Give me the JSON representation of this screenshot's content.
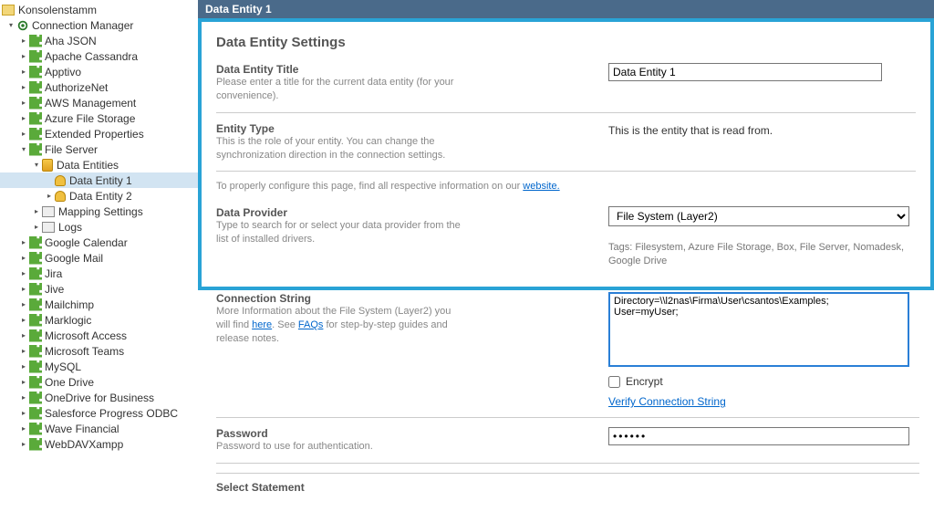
{
  "tree": {
    "root_label": "Konsolenstamm",
    "connection_manager": "Connection Manager",
    "items": [
      "Aha JSON",
      "Apache Cassandra",
      "Apptivo",
      "AuthorizeNet",
      "AWS Management",
      "Azure File Storage",
      "Extended Properties",
      "File Server",
      "Google Calendar",
      "Google Mail",
      "Jira",
      "Jive",
      "Mailchimp",
      "Marklogic",
      "Microsoft Access",
      "Microsoft Teams",
      "MySQL",
      "One Drive",
      "OneDrive for Business",
      "Salesforce Progress ODBC",
      "Wave Financial",
      "WebDAVXampp"
    ],
    "file_server_children": {
      "data_entities": "Data Entities",
      "entity1": "Data Entity 1",
      "entity2": "Data Entity 2",
      "mapping": "Mapping Settings",
      "logs": "Logs"
    }
  },
  "header": {
    "title": "Data Entity 1"
  },
  "form": {
    "section_title": "Data Entity Settings",
    "title_label": "Data Entity Title",
    "title_desc": "Please enter a title for the current data entity (for your convenience).",
    "title_value": "Data Entity 1",
    "entity_type_label": "Entity Type",
    "entity_type_desc": "This is the role of your entity. You can change the synchronization direction in the connection settings.",
    "entity_type_value": "This is the entity that is read from.",
    "info_prefix": "To properly configure this page, find all respective information on our ",
    "info_link": "website.",
    "provider_label": "Data Provider",
    "provider_desc": "Type to search for or select your data provider from the list of installed drivers.",
    "provider_value": "File System (Layer2)",
    "tags": "Tags: Filesystem, Azure File Storage, Box, File Server, Nomadesk, Google Drive",
    "conn_label": "Connection String",
    "conn_desc_pre": "More Information about the File System (Layer2) you will find ",
    "conn_here": "here",
    "conn_desc_mid": ". See ",
    "conn_faqs": "FAQs",
    "conn_desc_post": " for step-by-step guides and release notes.",
    "conn_value": "Directory=\\\\l2nas\\Firma\\User\\csantos\\Examples;\nUser=myUser;",
    "encrypt_label": "Encrypt",
    "verify_label": "Verify Connection String",
    "password_label": "Password",
    "password_desc": "Password to use for authentication.",
    "password_value": "••••••",
    "select_label": "Select Statement"
  }
}
